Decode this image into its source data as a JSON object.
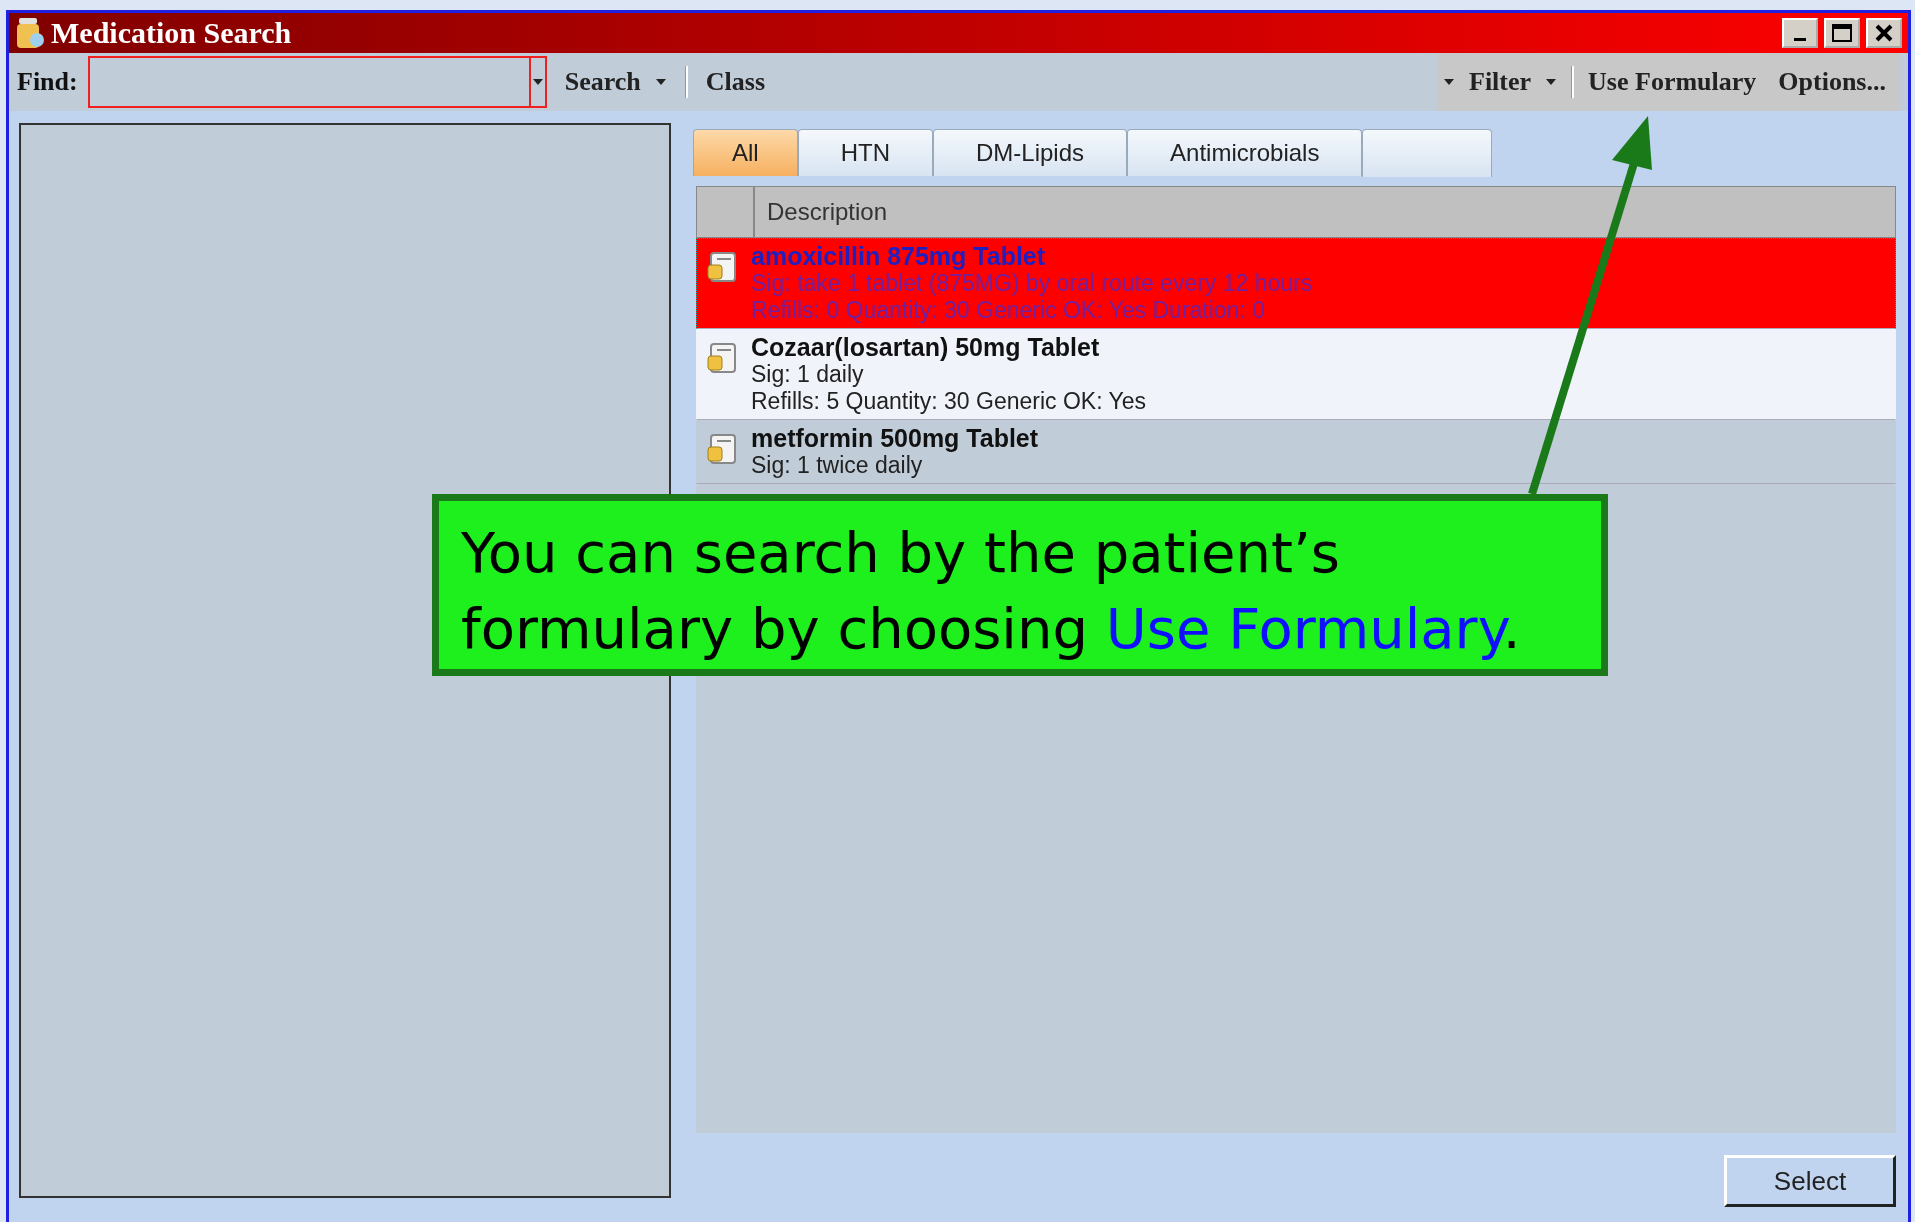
{
  "window": {
    "title": "Medication Search"
  },
  "toolbar": {
    "find_label": "Find:",
    "items": [
      {
        "label": "Search",
        "kind": "dropdown"
      },
      {
        "label": "Class",
        "kind": "plain"
      }
    ],
    "right_items": [
      {
        "label": "Filter",
        "kind": "dropdown"
      },
      {
        "label": "Use Formulary",
        "kind": "plain"
      },
      {
        "label": "Options...",
        "kind": "plain"
      }
    ]
  },
  "tabs": [
    {
      "label": "All",
      "selected": true
    },
    {
      "label": "HTN",
      "selected": false
    },
    {
      "label": "DM-Lipids",
      "selected": false
    },
    {
      "label": "Antimicrobials",
      "selected": false
    }
  ],
  "table": {
    "columns": [
      "Description"
    ],
    "rows": [
      {
        "name": "amoxicillin 875mg Tablet",
        "lines": [
          "Sig: take 1 tablet (875MG)  by oral route  every 12 hours",
          "Refills: 0 Quantity: 30 Generic OK: Yes Duration: 0"
        ],
        "selected": true
      },
      {
        "name": "Cozaar(losartan) 50mg Tablet",
        "lines": [
          "Sig: 1 daily",
          "Refills: 5 Quantity: 30 Generic OK: Yes"
        ],
        "selected": false
      },
      {
        "name": "metformin 500mg Tablet",
        "lines": [
          "Sig: 1 twice daily"
        ],
        "selected": false
      }
    ]
  },
  "buttons": [
    "Select"
  ],
  "callout": {
    "text": "You can search by the patient’s formulary by choosing ",
    "highlight": "Use Formulary",
    "end": "."
  }
}
